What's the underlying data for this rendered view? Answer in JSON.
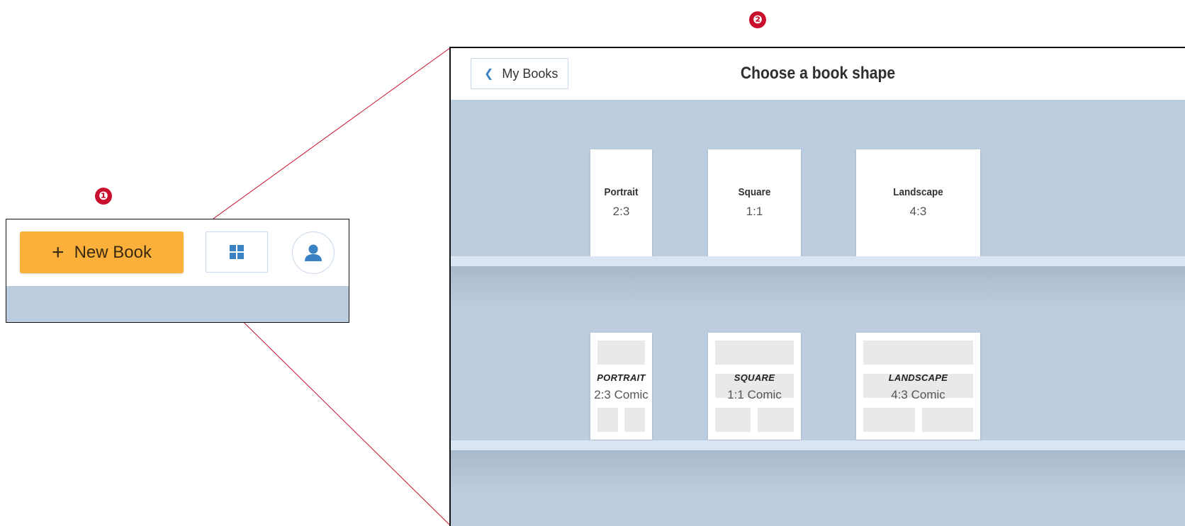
{
  "markers": {
    "step1": "❶",
    "step2": "❷"
  },
  "toolbar": {
    "new_book_plus": "+",
    "new_book_label": "New Book",
    "grid_icon": "grid-view-icon",
    "avatar_icon": "user-avatar-icon"
  },
  "app": {
    "back_label": "My Books",
    "back_icon": "chevron-left-icon",
    "title": "Choose a book shape"
  },
  "shapes": [
    {
      "name": "Portrait",
      "ratio": "2:3"
    },
    {
      "name": "Square",
      "ratio": "1:1"
    },
    {
      "name": "Landscape",
      "ratio": "4:3"
    }
  ],
  "comic_shapes": [
    {
      "name": "PORTRAIT",
      "ratio": "2:3 Comic"
    },
    {
      "name": "SQUARE",
      "ratio": "1:1 Comic"
    },
    {
      "name": "LANDSCAPE",
      "ratio": "4:3 Comic"
    }
  ],
  "colors": {
    "accent_orange": "#fbb03b",
    "marker_red": "#c8102e",
    "shelf_blue": "#bccde0",
    "icon_blue": "#3b82c4"
  }
}
